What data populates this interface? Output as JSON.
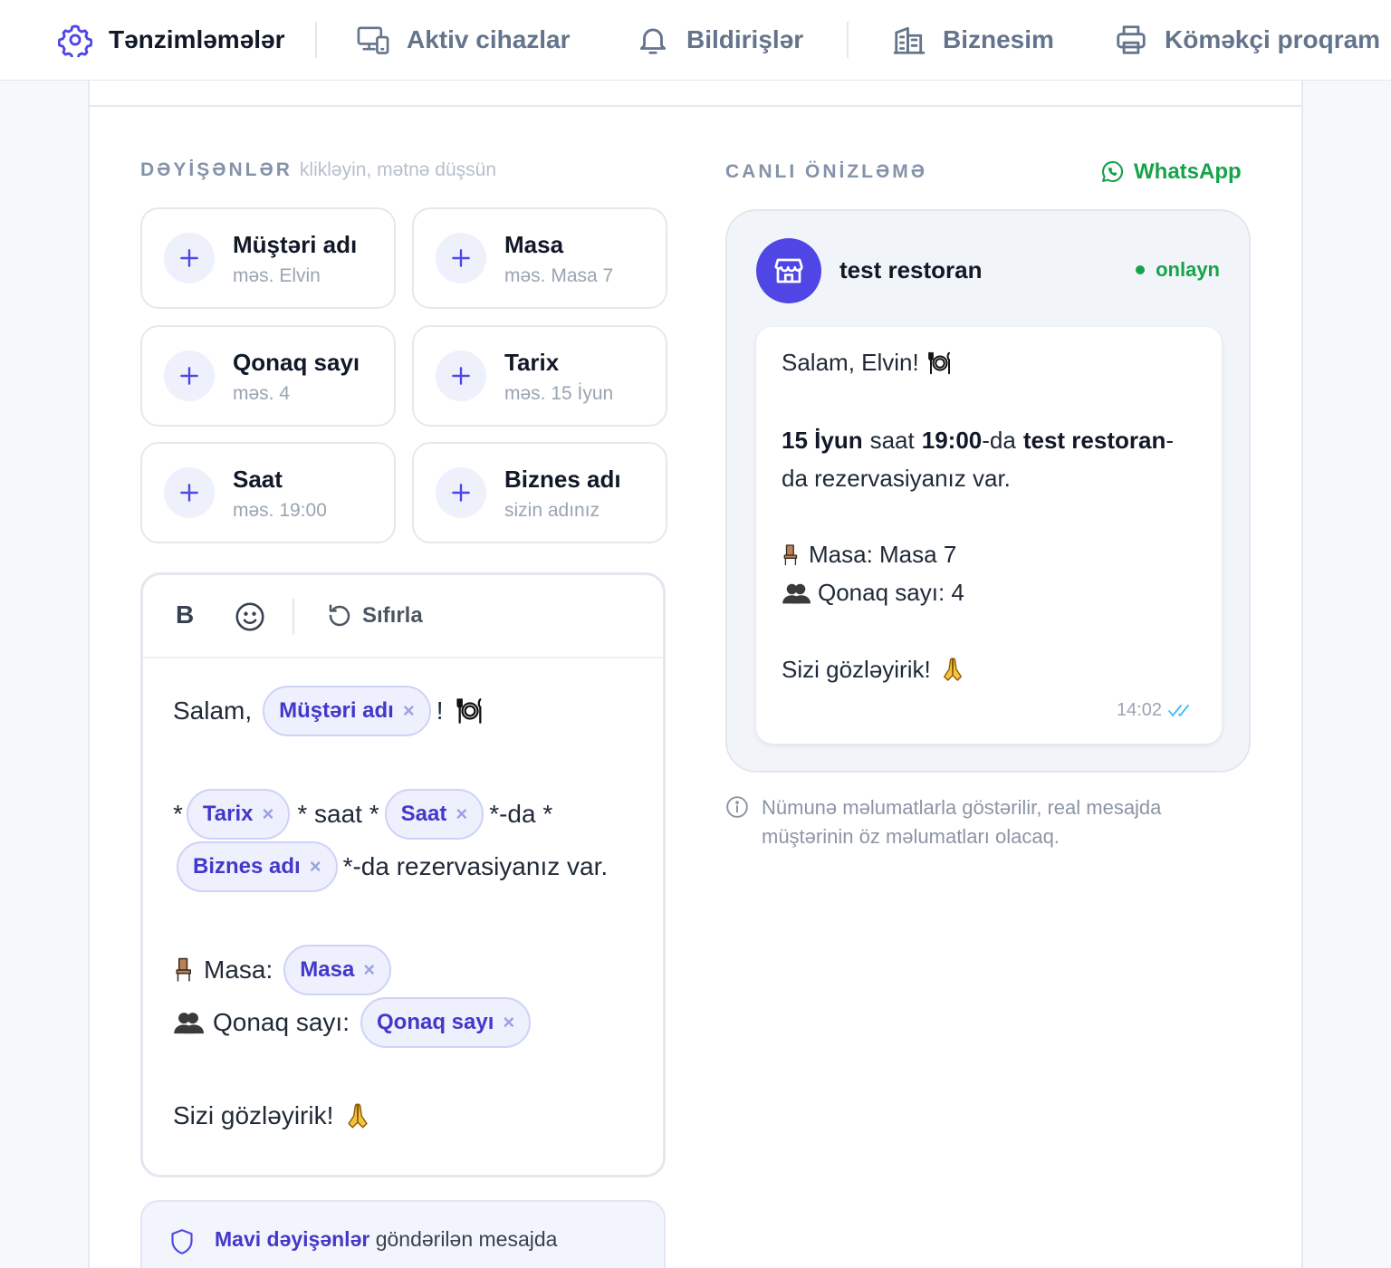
{
  "nav": {
    "items": [
      {
        "label": "Tənzimləmələr",
        "icon": "gear-icon",
        "active": true
      },
      {
        "label": "Aktiv cihazlar",
        "icon": "devices-icon",
        "active": false
      },
      {
        "label": "Bildirişlər",
        "icon": "bell-icon",
        "active": false
      },
      {
        "label": "Biznesim",
        "icon": "building-icon",
        "active": false
      },
      {
        "label": "Köməkçi proqram",
        "icon": "printer-icon",
        "active": false
      }
    ]
  },
  "variables": {
    "heading": "DƏYİŞƏNLƏR",
    "hint": "klikləyin, mətnə düşsün",
    "items": [
      {
        "title": "Müştəri adı",
        "example": "məs. Elvin"
      },
      {
        "title": "Masa",
        "example": "məs. Masa 7"
      },
      {
        "title": "Qonaq sayı",
        "example": "məs. 4"
      },
      {
        "title": "Tarix",
        "example": "məs. 15 İyun"
      },
      {
        "title": "Saat",
        "example": "məs. 19:00"
      },
      {
        "title": "Biznes adı",
        "example": "sizin adınız"
      }
    ]
  },
  "editor": {
    "bold_label": "B",
    "reset_label": "Sıfırla",
    "line1": {
      "prefix": "Salam,",
      "chip": "Müştəri adı",
      "suffix": "!"
    },
    "line2": {
      "t1": "*",
      "chip1": "Tarix",
      "t2": "* saat *",
      "chip2": "Saat",
      "t3": "*-da *"
    },
    "line3": {
      "chip": "Biznes adı",
      "suffix": "*-da rezervasiyanız var."
    },
    "line4": {
      "label": "Masa:",
      "chip": "Masa"
    },
    "line5": {
      "label": "Qonaq sayı:",
      "chip": "Qonaq sayı"
    },
    "line6": {
      "text": "Sizi gözləyirik!"
    },
    "chip_remove": "×"
  },
  "info": {
    "highlight": "Mavi dəyişənlər",
    "text": "göndərilən mesajda"
  },
  "preview": {
    "heading": "CANLI ÖNİZLƏMƏ",
    "channel": "WhatsApp",
    "business_name": "test restoran",
    "status": "onlayn",
    "message": {
      "greeting": "Salam, Elvin!",
      "date": "15 İyun",
      "saat": "saat",
      "time": "19:00",
      "da": "-da",
      "business": "test restoran",
      "dash": "-",
      "line2": "da rezervasiyanız var.",
      "table": "Masa: Masa 7",
      "guests": "Qonaq sayı: 4",
      "closing": "Sizi gözləyirik!"
    },
    "timestamp": "14:02"
  },
  "note": {
    "line1": "Nümunə məlumatlarla göstərilir, real mesajda",
    "line2": "müştərinin öz məlumatları olacaq."
  },
  "colors": {
    "accent": "#4f46e5",
    "whatsapp": "#16a34a",
    "chip_bg": "#eef0fd"
  }
}
